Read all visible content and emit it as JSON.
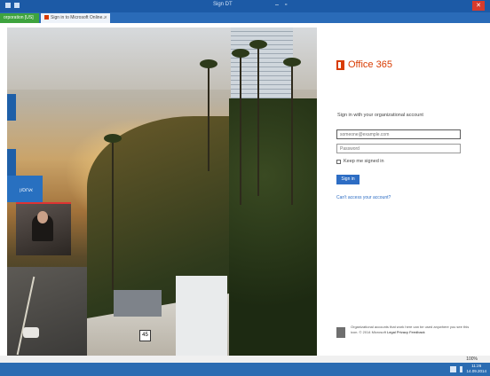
{
  "window": {
    "title": "Sign DT",
    "controls": [
      "–",
      "▫",
      "✕"
    ]
  },
  "tabs": [
    {
      "label": "orporation [US]"
    },
    {
      "label": "Sign in to Microsoft Online...",
      "close": "✕"
    }
  ],
  "browser_tools": [
    "⌂",
    "☆",
    "⚙"
  ],
  "hero": {
    "tile_label": "אחסון",
    "highway_number": "45"
  },
  "signin": {
    "brand": "Office 365",
    "heading": "Sign in with your organizational account",
    "username_placeholder": "someone@example.com",
    "password_placeholder": "Password",
    "keep_signed_in": "Keep me signed in",
    "button": "Sign in",
    "cant_access": "Can't access your account?",
    "footer_text": "Organizational accounts that work here can be used anywhere you see this icon. © 2014 Microsoft",
    "footer_links": "Legal Privacy Feedback"
  },
  "status": {
    "zoom": "100%"
  },
  "taskbar": {
    "time": "11:26",
    "date": "14.09.2014"
  },
  "colors": {
    "office_orange": "#d83b01",
    "titlebar_blue": "#1c5aa6",
    "button_blue": "#2d6dc4"
  }
}
